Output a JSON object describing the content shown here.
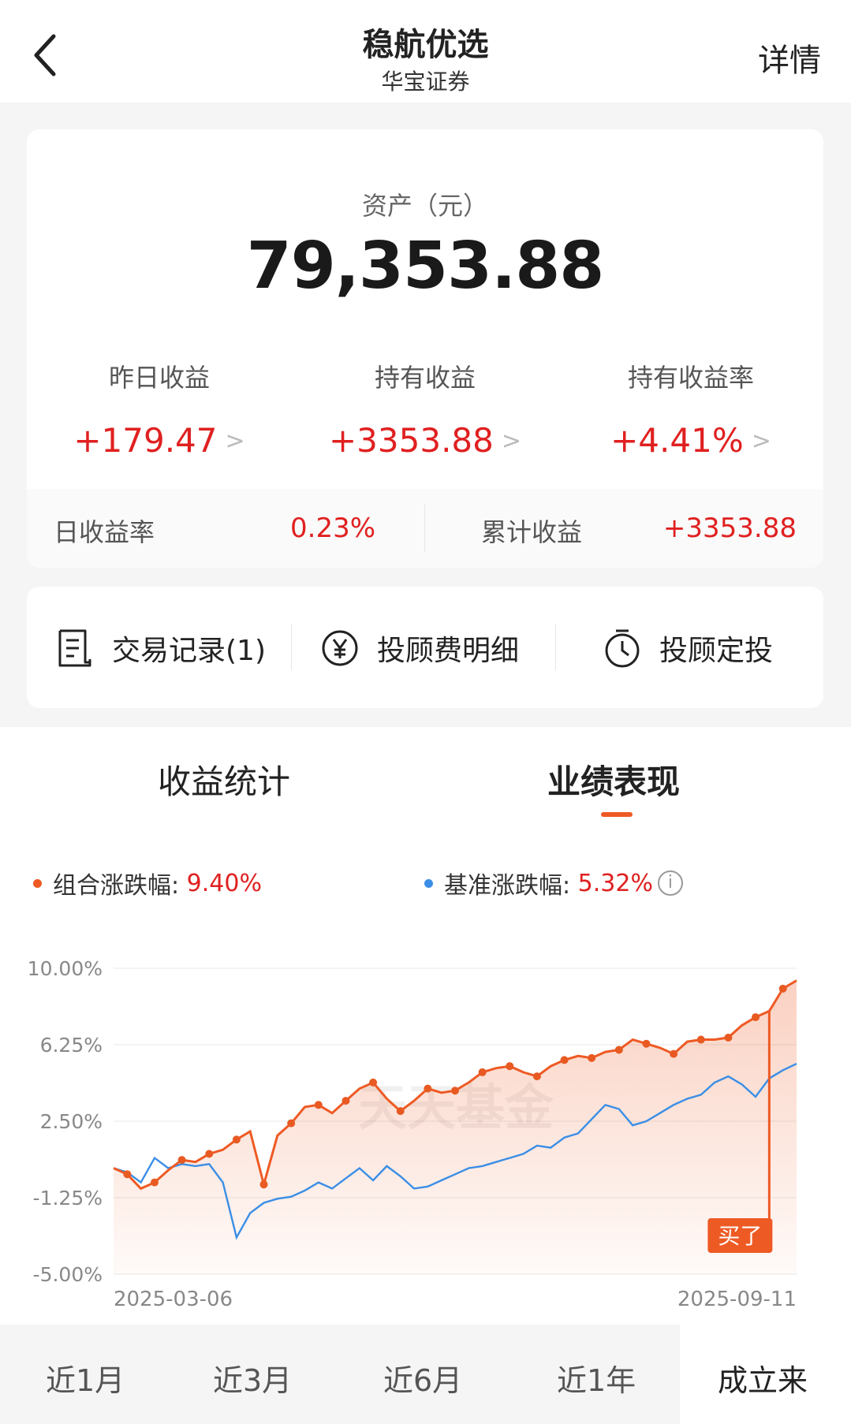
{
  "header": {
    "title": "稳航优选",
    "subtitle": "华宝证券",
    "detail": "详情"
  },
  "asset": {
    "label": "资产（元）",
    "value": "79,353.88",
    "stats": [
      {
        "label": "昨日收益",
        "value": "+179.47"
      },
      {
        "label": "持有收益",
        "value": "+3353.88"
      },
      {
        "label": "持有收益率",
        "value": "+4.41%"
      }
    ],
    "footer": {
      "daily_rate_label": "日收益率",
      "daily_rate_value": "0.23%",
      "total_label": "累计收益",
      "total_value": "+3353.88"
    }
  },
  "actions": [
    {
      "label": "交易记录(1)",
      "icon": "receipt-icon"
    },
    {
      "label": "投顾费明细",
      "icon": "yen-icon"
    },
    {
      "label": "投顾定投",
      "icon": "timer-icon"
    }
  ],
  "tabs": [
    {
      "label": "收益统计"
    },
    {
      "label": "业绩表现",
      "active": true
    }
  ],
  "legend": {
    "portfolio_label": "组合涨跌幅:",
    "portfolio_value": "9.40%",
    "benchmark_label": "基准涨跌幅:",
    "benchmark_value": "5.32%"
  },
  "watermark": "天天基金",
  "buy_marker": "买了",
  "ranges": [
    {
      "label": "近1月"
    },
    {
      "label": "近3月"
    },
    {
      "label": "近6月"
    },
    {
      "label": "近1年"
    },
    {
      "label": "成立来",
      "active": true
    }
  ],
  "colors": {
    "portfolio": "#ee5a24",
    "benchmark": "#3a8ee6",
    "up": "#e02020"
  },
  "chart_data": {
    "type": "line",
    "x_start_label": "2025-03-06",
    "x_end_label": "2025-09-11",
    "ylim": [
      -5,
      10
    ],
    "yticks": [
      "10.00%",
      "6.25%",
      "2.50%",
      "-1.25%",
      "-5.00%"
    ],
    "series": [
      {
        "name": "组合涨跌幅",
        "values": [
          0.2,
          -0.1,
          -0.8,
          -0.5,
          0.1,
          0.6,
          0.5,
          0.9,
          1.1,
          1.6,
          2.0,
          -0.6,
          1.8,
          2.4,
          3.2,
          3.3,
          2.9,
          3.5,
          4.1,
          4.4,
          3.6,
          3.0,
          3.5,
          4.1,
          3.9,
          4.0,
          4.4,
          4.9,
          5.1,
          5.2,
          4.9,
          4.7,
          5.2,
          5.5,
          5.7,
          5.6,
          5.9,
          6.0,
          6.5,
          6.3,
          6.1,
          5.8,
          6.4,
          6.5,
          6.5,
          6.6,
          7.2,
          7.6,
          7.9,
          9.0,
          9.4
        ]
      },
      {
        "name": "基准涨跌幅",
        "values": [
          0.2,
          0.0,
          -0.5,
          0.7,
          0.2,
          0.4,
          0.3,
          0.4,
          -0.5,
          -3.2,
          -2.0,
          -1.5,
          -1.3,
          -1.2,
          -0.9,
          -0.5,
          -0.8,
          -0.3,
          0.2,
          -0.4,
          0.3,
          -0.2,
          -0.8,
          -0.7,
          -0.4,
          -0.1,
          0.2,
          0.3,
          0.5,
          0.7,
          0.9,
          1.3,
          1.2,
          1.7,
          1.9,
          2.6,
          3.3,
          3.1,
          2.3,
          2.5,
          2.9,
          3.3,
          3.6,
          3.8,
          4.4,
          4.7,
          4.3,
          3.7,
          4.6,
          5.0,
          5.32
        ]
      }
    ]
  }
}
